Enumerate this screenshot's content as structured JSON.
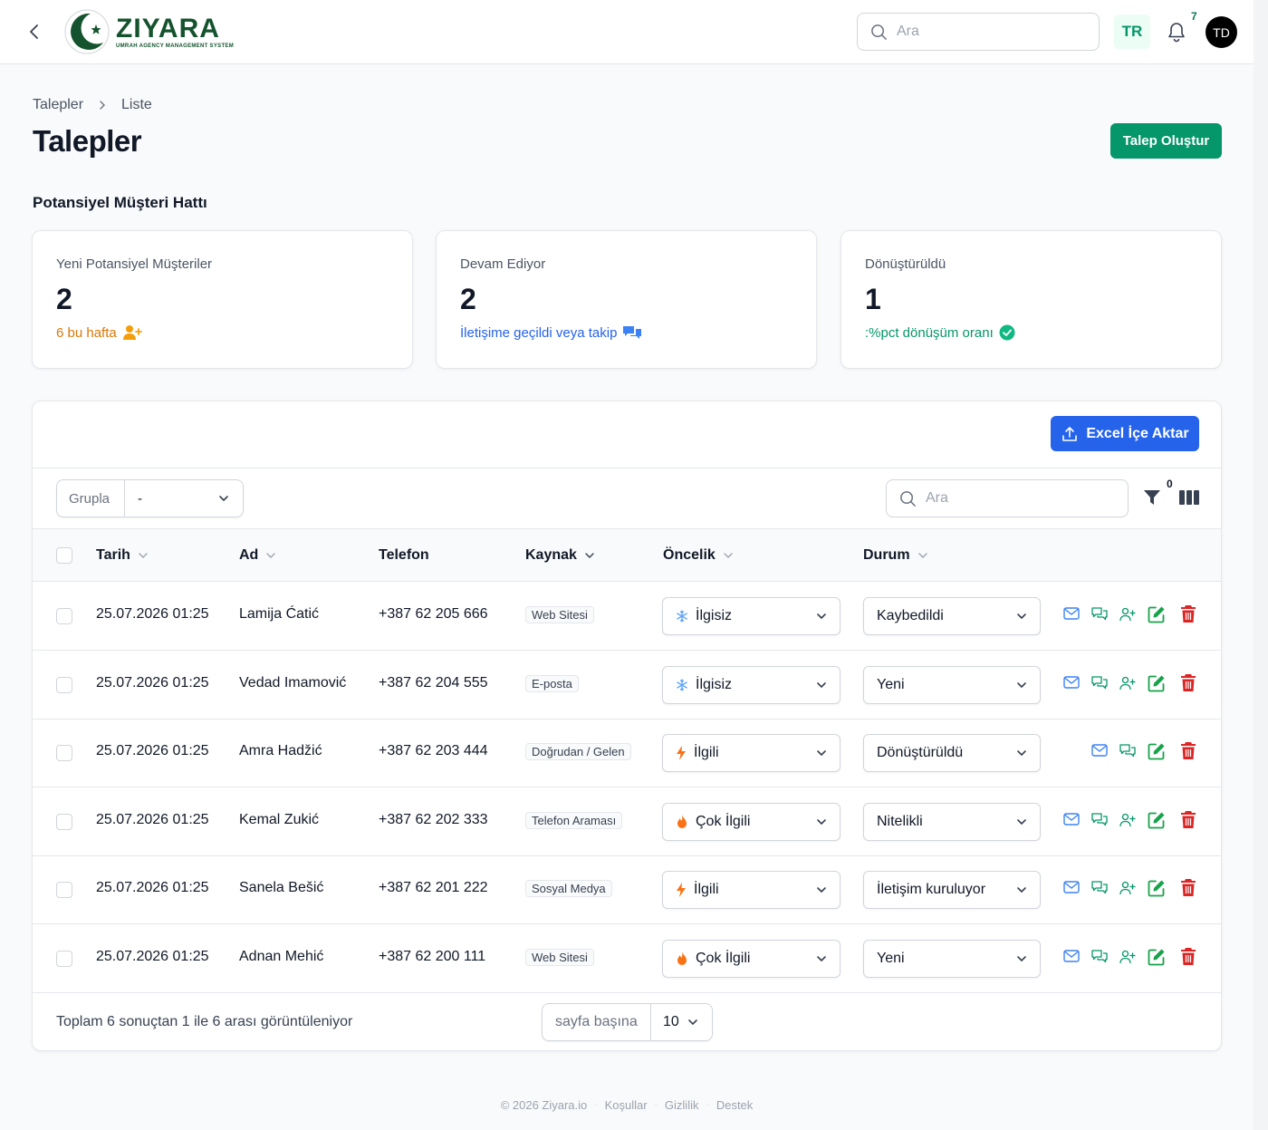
{
  "app": {
    "logo_name": "ZIYARA",
    "logo_subtitle": "UMRAH AGENCY MANAGEMENT SYSTEM"
  },
  "header": {
    "search_placeholder": "Ara",
    "language": "TR",
    "notification_count": "7",
    "avatar_initials": "TD"
  },
  "breadcrumb": {
    "items": [
      "Talepler",
      "Liste"
    ]
  },
  "page": {
    "title": "Talepler",
    "create_button": "Talep Oluştur",
    "section_title": "Potansiyel Müşteri Hattı"
  },
  "cards": [
    {
      "label": "Yeni Potansiyel Müşteriler",
      "value": "2",
      "note": "6 bu hafta",
      "note_color": "#d97706",
      "icon": "user-plus-icon"
    },
    {
      "label": "Devam Ediyor",
      "value": "2",
      "note": "İletişime geçildi veya takip",
      "note_color": "#2563eb",
      "icon": "chat-bubbles-icon"
    },
    {
      "label": "Dönüştürüldü",
      "value": "1",
      "note": ":%pct dönüşüm oranı",
      "note_color": "#059669",
      "icon": "check-badge-icon"
    }
  ],
  "toolbar": {
    "excel_button": "Excel İçe Aktar",
    "group_label": "Grupla",
    "group_value": "-",
    "search_placeholder": "Ara",
    "filter_count": "0"
  },
  "table": {
    "columns": [
      "Tarih",
      "Ad",
      "Telefon",
      "Kaynak",
      "Öncelik",
      "Durum"
    ],
    "rows": [
      {
        "date": "25.07.2026 01:25",
        "name": "Lamija Ćatić",
        "phone": "+387 62 205 666",
        "source": "Web Sitesi",
        "priority": "İlgisiz",
        "priority_icon": "snowflake-icon",
        "status": "Kaybedildi",
        "convertible": true
      },
      {
        "date": "25.07.2026 01:25",
        "name": "Vedad Imamović",
        "phone": "+387 62 204 555",
        "source": "E-posta",
        "priority": "İlgisiz",
        "priority_icon": "snowflake-icon",
        "status": "Yeni",
        "convertible": true
      },
      {
        "date": "25.07.2026 01:25",
        "name": "Amra Hadžić",
        "phone": "+387 62 203 444",
        "source": "Doğrudan / Gelen",
        "priority": "İlgili",
        "priority_icon": "bolt-icon",
        "status": "Dönüştürüldü",
        "convertible": false
      },
      {
        "date": "25.07.2026 01:25",
        "name": "Kemal Zukić",
        "phone": "+387 62 202 333",
        "source": "Telefon Araması",
        "priority": "Çok İlgili",
        "priority_icon": "fire-icon",
        "status": "Nitelikli",
        "convertible": true
      },
      {
        "date": "25.07.2026 01:25",
        "name": "Sanela Bešić",
        "phone": "+387 62 201 222",
        "source": "Sosyal Medya",
        "priority": "İlgili",
        "priority_icon": "bolt-icon",
        "status": "İletişim kuruluyor",
        "convertible": true
      },
      {
        "date": "25.07.2026 01:25",
        "name": "Adnan Mehić",
        "phone": "+387 62 200 111",
        "source": "Web Sitesi",
        "priority": "Çok İlgili",
        "priority_icon": "fire-icon",
        "status": "Yeni",
        "convertible": true
      }
    ]
  },
  "pagination": {
    "summary": "Toplam 6 sonuçtan 1 ile 6 arası görüntüleniyor",
    "per_page_label": "sayfa başına",
    "per_page_value": "10"
  },
  "footer": {
    "copyright": "© 2026 Ziyara.io",
    "links": [
      "Koşullar",
      "Gizlilik",
      "Destek"
    ]
  },
  "colors": {
    "brand_green": "#059669",
    "primary_blue": "#2563eb",
    "danger_red": "#dc2626"
  }
}
